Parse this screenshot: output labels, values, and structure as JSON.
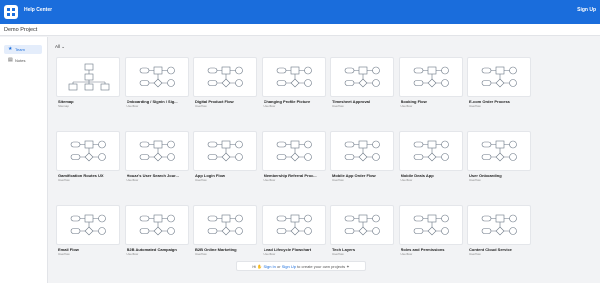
{
  "topbar": {
    "help_label": "Help Center",
    "signup_label": "Sign Up",
    "accent": "#1a6ddc"
  },
  "project": {
    "title": "Demo Project"
  },
  "sidebar": {
    "items": [
      {
        "label": "Team",
        "icon": "star-icon",
        "active": true
      },
      {
        "label": "Notes",
        "icon": "note-icon",
        "active": false
      }
    ]
  },
  "filter": {
    "label": "All",
    "icon": "chevron-down-icon"
  },
  "cards": [
    {
      "title": "Sitemap",
      "subtitle": "Sitemap",
      "thumbnail": "sitemap"
    },
    {
      "title": "Onboarding / Signin / Sig...",
      "subtitle": "Userflow",
      "thumbnail": "userflow"
    },
    {
      "title": "Digital Product Flow",
      "subtitle": "Userflow",
      "thumbnail": "userflow"
    },
    {
      "title": "Changing Profile Picture",
      "subtitle": "Userflow",
      "thumbnail": "userflow"
    },
    {
      "title": "Timesheet Approval",
      "subtitle": "Userflow",
      "thumbnail": "userflow"
    },
    {
      "title": "Booking Flow",
      "subtitle": "Userflow",
      "thumbnail": "userflow"
    },
    {
      "title": "E-com Order Process",
      "subtitle": "Userflow",
      "thumbnail": "userflow"
    },
    {
      "title": "Gamification Routes UX",
      "subtitle": "Userflow",
      "thumbnail": "userflow"
    },
    {
      "title": "Houzz's User Search Jour...",
      "subtitle": "Userflow",
      "thumbnail": "userflow"
    },
    {
      "title": "App Login Flow",
      "subtitle": "Userflow",
      "thumbnail": "userflow"
    },
    {
      "title": "Membership Referral Proc...",
      "subtitle": "Userflow",
      "thumbnail": "userflow"
    },
    {
      "title": "Mobile App Order Flow",
      "subtitle": "Userflow",
      "thumbnail": "userflow"
    },
    {
      "title": "Mobile Deals App",
      "subtitle": "Userflow",
      "thumbnail": "userflow"
    },
    {
      "title": "User Onboarding",
      "subtitle": "Userflow",
      "thumbnail": "userflow"
    },
    {
      "title": "Email Flow",
      "subtitle": "Userflow",
      "thumbnail": "userflow"
    },
    {
      "title": "B2B Automated Campaign",
      "subtitle": "Userflow",
      "thumbnail": "userflow"
    },
    {
      "title": "B2B Online Marketing",
      "subtitle": "Userflow",
      "thumbnail": "userflow"
    },
    {
      "title": "Lead Lifecycle Flowchart",
      "subtitle": "Userflow",
      "thumbnail": "userflow"
    },
    {
      "title": "Tech Layers",
      "subtitle": "Userflow",
      "thumbnail": "userflow"
    },
    {
      "title": "Roles and Permissions",
      "subtitle": "Userflow",
      "thumbnail": "userflow"
    },
    {
      "title": "Content Cloud Service",
      "subtitle": "Userflow",
      "thumbnail": "userflow"
    }
  ],
  "banner": {
    "prefix": "Hi",
    "signin_label": "Sign In",
    "or": "or",
    "signup_label": "Sign Up",
    "suffix": "to create your own projects"
  }
}
